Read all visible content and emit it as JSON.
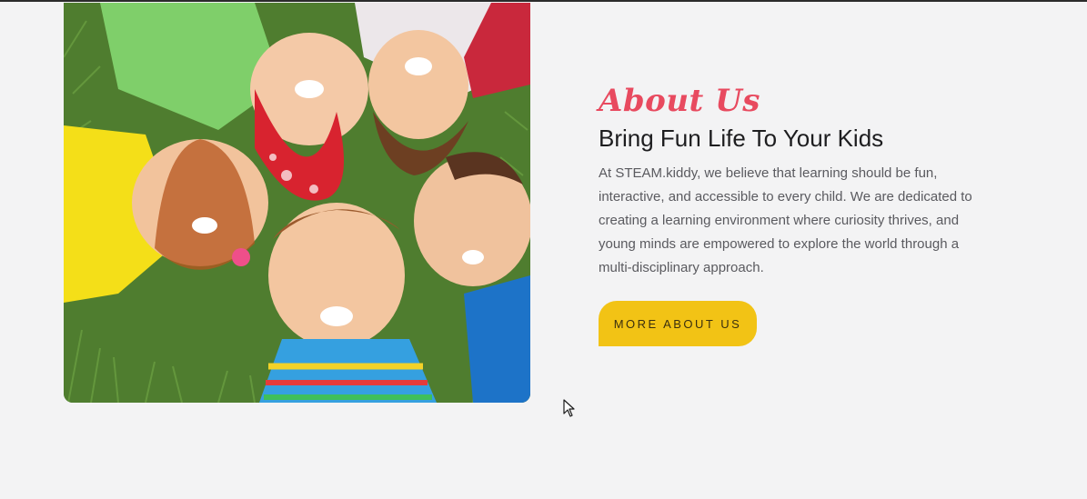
{
  "about": {
    "kicker": "About Us",
    "title": "Bring Fun Life To Your Kids",
    "body": "At STEAM.kiddy, we believe that learning should be fun, interactive, and accessible to every child. We are dedicated to creating a learning environment where curiosity thrives, and young minds are empowered to explore the world through a multi-disciplinary approach.",
    "cta_label": "MORE ABOUT US"
  },
  "colors": {
    "page_bg": "#f3f3f4",
    "accent_red": "#e84a5f",
    "cta_yellow": "#f2c315",
    "title": "#1d1d1f",
    "body": "#5a5a5f"
  },
  "icons": {
    "cursor": "mouse-pointer-icon"
  }
}
